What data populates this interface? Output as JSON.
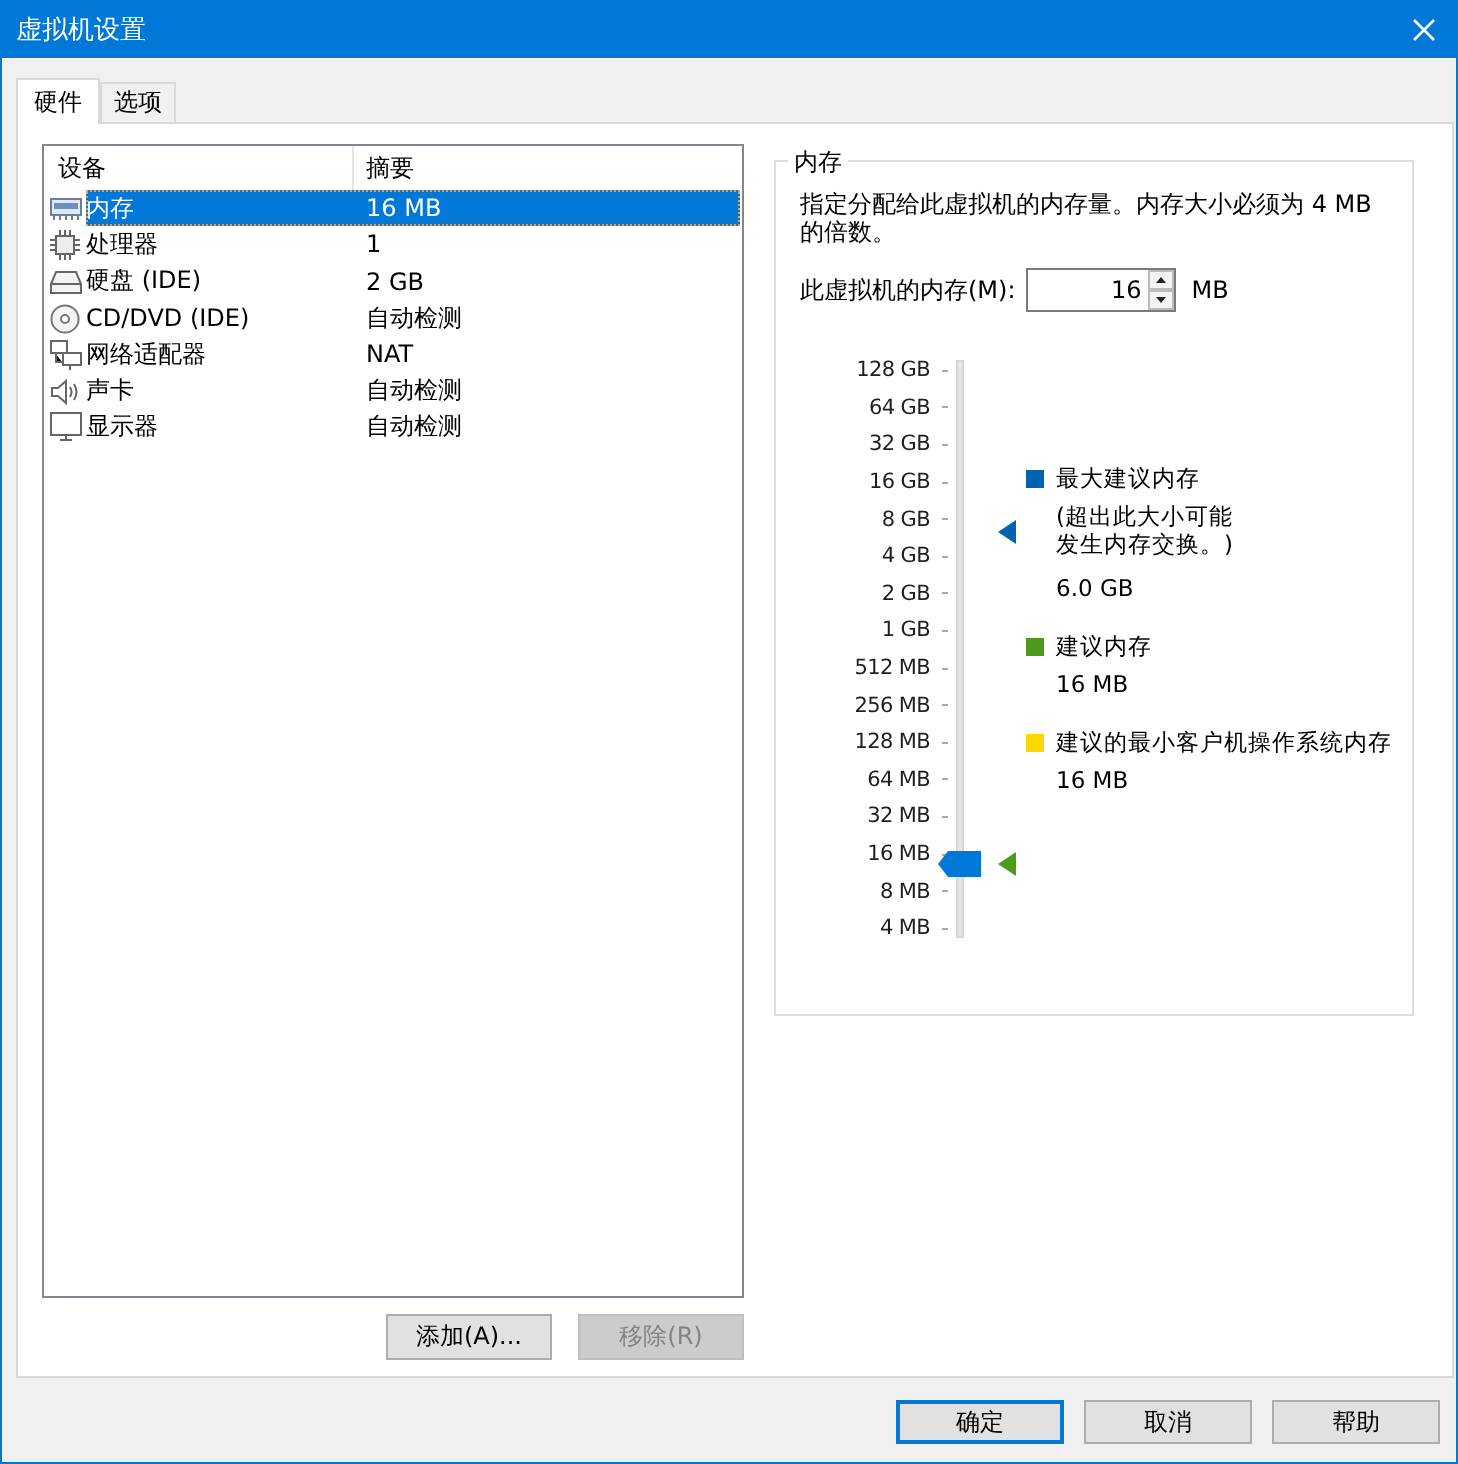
{
  "window": {
    "title": "虚拟机设置"
  },
  "tabs": [
    {
      "label": "硬件",
      "selected": true
    },
    {
      "label": "选项",
      "selected": false
    }
  ],
  "device_list": {
    "columns": [
      "设备",
      "摘要"
    ],
    "rows": [
      {
        "kind": "memory",
        "device": "内存",
        "summary": "16 MB",
        "selected": true
      },
      {
        "kind": "processor",
        "device": "处理器",
        "summary": "1",
        "selected": false
      },
      {
        "kind": "disk",
        "device": "硬盘 (IDE)",
        "summary": "2 GB",
        "selected": false
      },
      {
        "kind": "cdrom",
        "device": "CD/DVD (IDE)",
        "summary": "自动检测",
        "selected": false
      },
      {
        "kind": "network",
        "device": "网络适配器",
        "summary": "NAT",
        "selected": false
      },
      {
        "kind": "sound",
        "device": "声卡",
        "summary": "自动检测",
        "selected": false
      },
      {
        "kind": "display",
        "device": "显示器",
        "summary": "自动检测",
        "selected": false
      }
    ],
    "buttons": [
      {
        "label": "添加(A)...",
        "disabled": false
      },
      {
        "label": "移除(R)",
        "disabled": true
      }
    ]
  },
  "memory": {
    "title": "内存",
    "description": "指定分配给此虚拟机的内存量。内存大小必须为 4 MB 的倍数。",
    "field_label": "此虚拟机的内存(M):",
    "value": "16",
    "unit": "MB",
    "scale": [
      "128 GB",
      "64 GB",
      "32 GB",
      "16 GB",
      "8 GB",
      "4 GB",
      "2 GB",
      "1 GB",
      "512 MB",
      "256 MB",
      "128 MB",
      "64 MB",
      "32 MB",
      "16 MB",
      "8 MB",
      "4 MB"
    ],
    "slider": {
      "level": 0.133
    },
    "legend": [
      {
        "title": "最大建议内存",
        "note": [
          "(超出此大小可能",
          "发生内存交换。)"
        ],
        "value": "6.0 GB",
        "color": "#0063b1",
        "level": 0.705
      },
      {
        "title": "建议内存",
        "value": "16 MB",
        "color": "#4b9a1a",
        "level": 0.133
      },
      {
        "title": "建议的最小客户机操作系统内存",
        "value": "16 MB",
        "color": "#ffd800"
      }
    ]
  },
  "buttons": [
    {
      "label": "确定",
      "default": true
    },
    {
      "label": "取消",
      "default": false
    },
    {
      "label": "帮助",
      "default": false
    }
  ]
}
